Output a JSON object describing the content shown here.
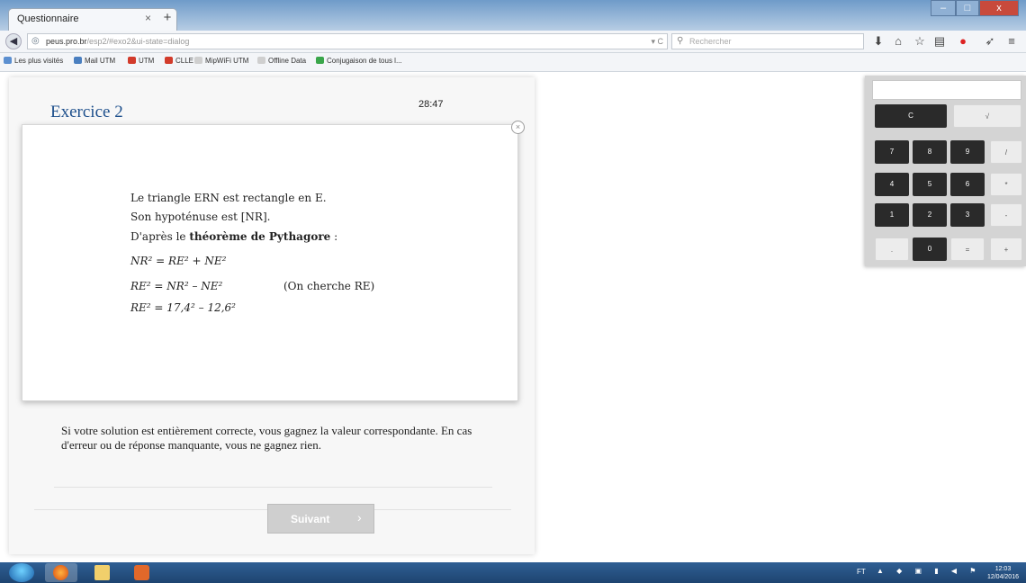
{
  "browser": {
    "tab_title": "Questionnaire",
    "tab_close": "×",
    "new_tab": "+",
    "window_controls": {
      "minimize": "–",
      "maximize": "□",
      "close": "x"
    },
    "back": "◀",
    "url_host": "peus.pro.br",
    "url_rest": "/esp2/#exo2&ui-state=dialog",
    "url_tools": "▾ C",
    "search_placeholder": "Rechercher"
  },
  "bookmarks": [
    {
      "label": "Les plus visités",
      "color": "#5b8fd0"
    },
    {
      "label": "Mail UTM",
      "color": "#4a7fc0"
    },
    {
      "label": "UTM",
      "color": "#d23b2b"
    },
    {
      "label": "CLLE",
      "color": "#d23b2b"
    },
    {
      "label": "MipWiFi UTM",
      "color": "#cfcfcf"
    },
    {
      "label": "Offline Data",
      "color": "#cfcfcf"
    },
    {
      "label": "Conjugaison de tous l...",
      "color": "#3aa64a"
    }
  ],
  "quiz": {
    "title": "Exercice 2",
    "timer": "28:47",
    "card_close": "×",
    "line1": "Le triangle ERN est rectangle en E.",
    "line2": "Son hypoténuse est [NR].",
    "line3_pre": "D'après le ",
    "line3_bold": "théorème de Pythagore",
    "line3_post": " :",
    "eq1": "NR² = RE² + NE²",
    "eq2": "RE² = NR² – NE²",
    "eq2_note": "(On cherche RE)",
    "eq3": "RE² = 17,4² – 12,6²",
    "info": "Si votre solution est entièrement correcte, vous gagnez la valeur correspondante. En cas d'erreur ou de réponse manquante, vous ne gagnez rien.",
    "next_label": "Suivant",
    "next_arrow": "›"
  },
  "calculator": {
    "display": "",
    "keys": [
      {
        "label": "C",
        "style": "dark"
      },
      {
        "label": "√",
        "style": "light"
      },
      {
        "label": "7",
        "style": "dark"
      },
      {
        "label": "8",
        "style": "dark"
      },
      {
        "label": "9",
        "style": "dark"
      },
      {
        "label": "/",
        "style": "light"
      },
      {
        "label": "4",
        "style": "dark"
      },
      {
        "label": "5",
        "style": "dark"
      },
      {
        "label": "6",
        "style": "dark"
      },
      {
        "label": "*",
        "style": "light"
      },
      {
        "label": "1",
        "style": "dark"
      },
      {
        "label": "2",
        "style": "dark"
      },
      {
        "label": "3",
        "style": "dark"
      },
      {
        "label": "-",
        "style": "light"
      },
      {
        "label": ".",
        "style": "light"
      },
      {
        "label": "0",
        "style": "dark"
      },
      {
        "label": "=",
        "style": "light"
      },
      {
        "label": "+",
        "style": "light"
      }
    ]
  },
  "taskbar": {
    "lang": "FT",
    "tray_icons": "▲ ◆ ▣ ▮ ◀ ⚑",
    "clock_time": "12:03",
    "clock_date": "12/04/2016"
  }
}
